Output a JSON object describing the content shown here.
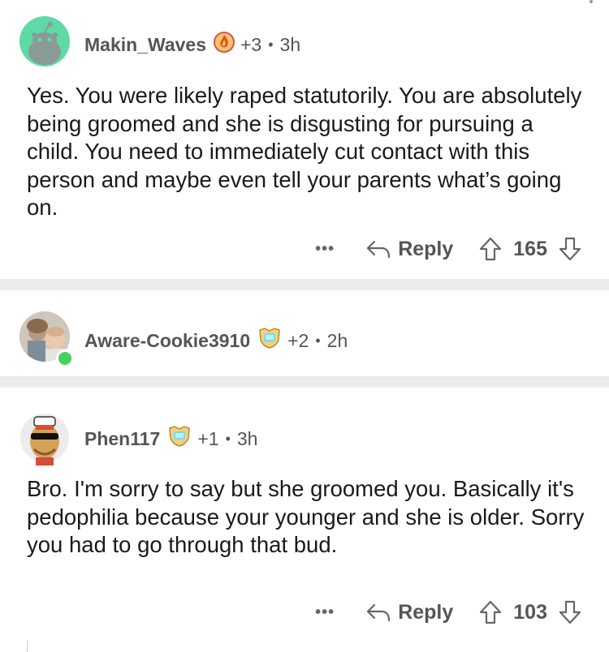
{
  "comments": [
    {
      "username": "Makin_Waves",
      "karma": "+3",
      "age": "3h",
      "text": "Yes. You were likely raped statutorily. You are absolutely being groomed and she is disgusting for pursuing a child. You need to immediately cut contact with this person and maybe even tell your parents what’s going on.",
      "more": "•••",
      "reply": "Reply",
      "votes": "165"
    },
    {
      "username": "Aware-Cookie3910",
      "karma": "+2",
      "age": "2h"
    },
    {
      "username": "Phen117",
      "karma": "+1",
      "age": "3h",
      "text": "Bro. I'm sorry to say but she groomed you. Basically it's pedophilia because your younger and she is older. Sorry you had to go through that bud.",
      "more": "•••",
      "reply": "Reply",
      "votes": "103"
    }
  ],
  "separator": "•",
  "colors": {
    "online": "#46d160",
    "divider": "#ececec",
    "snoo_bg": "#5fd9a6"
  }
}
